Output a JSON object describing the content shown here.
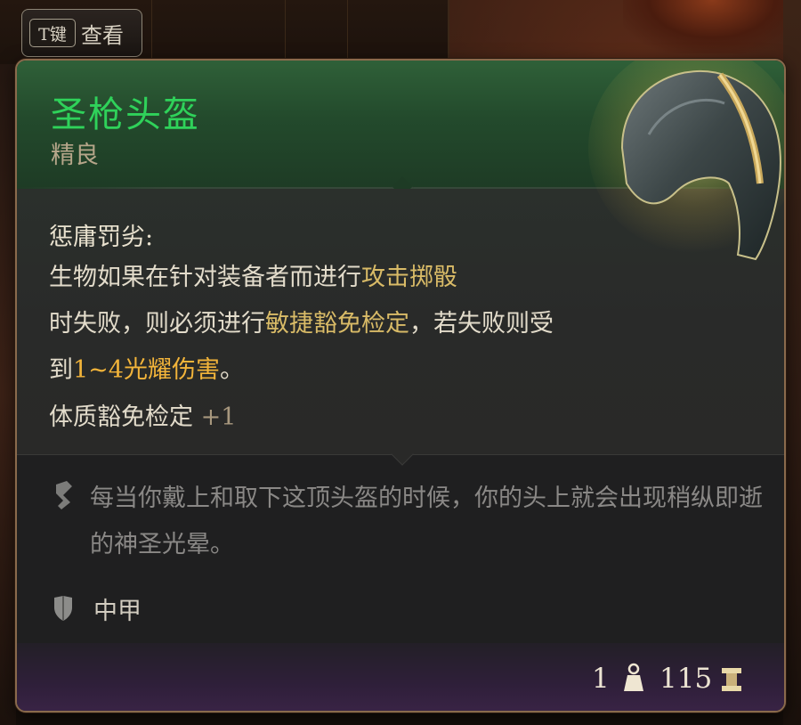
{
  "hotkey": {
    "key_label": "T键",
    "action_label": "查看"
  },
  "item": {
    "name": "圣枪头盔",
    "rarity": "精良",
    "name_color": "#2fd25a"
  },
  "ability": {
    "name": "惩庸罚劣:",
    "desc_part1": "生物如果在针对装备者而进行",
    "desc_attack_roll": "攻击掷骰",
    "desc_part2": "时失败，则必须进行",
    "desc_save": "敏捷豁免检定",
    "desc_part3": "，若失败则受到",
    "desc_damage": "1~4光耀伤害",
    "desc_part4": "。"
  },
  "bonus": {
    "label": "体质豁免检定",
    "value": "+1"
  },
  "flavor": {
    "icon": "quill-icon",
    "text": "每当你戴上和取下这顶头盔的时候，你的头上就会出现稍纵即逝的神圣光晕。"
  },
  "armor_type": {
    "icon": "shield-icon",
    "label": "中甲"
  },
  "footer": {
    "quantity": "1",
    "weight_icon": "weight-icon",
    "price": "115",
    "currency_icon": "gold-coin-icon"
  }
}
